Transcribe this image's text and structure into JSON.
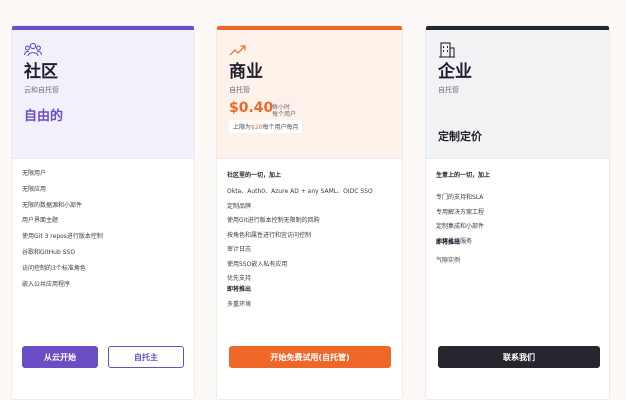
{
  "plans": [
    {
      "name": "社区",
      "subtitle": "云和自托管",
      "price": "自由的",
      "icon": "users-icon",
      "accent": "#6a4fc4",
      "features": [
        "无限用户",
        "无限应用",
        "无限的数据源和小部件",
        "用户界面主题",
        "使用Git 3 repos进行版本控制",
        "谷歌和GitHub SSO",
        "访问控制的3个标准角色",
        "嵌入公共应用程序"
      ],
      "buttons": [
        "从云开始",
        "自托主"
      ]
    },
    {
      "name": "商业",
      "subtitle": "自托管",
      "price": "$0.40",
      "price_note_1": "每小时",
      "price_note_2": "每个用户",
      "cap_prefix": "上限为",
      "cap_amount": "$20",
      "cap_suffix": "每个用户每月",
      "icon": "trending-up-icon",
      "accent": "#f0672a",
      "features": [
        "社区里的一切，加上",
        "Okta、Auth0、Azure AD + any SAML、OIDC SSO",
        "定制品牌",
        "使用Git进行版本控制无限制的回购",
        "按角色和属性进行和宜访问控制",
        "审计日志",
        "使用SSO嵌入私有应用",
        "优先支持"
      ],
      "section_title": "即将推出",
      "section_items": [
        "多重环境"
      ],
      "button": "开始免费试用(自托管)"
    },
    {
      "name": "企业",
      "subtitle": "自托管",
      "price": "定制定价",
      "icon": "building-icon",
      "accent": "#26262e",
      "features": [
        "生意上的一切，加上",
        "专门的支持和SLA",
        "专用解决方案工程",
        "定制集成和小部件",
        "应用迁移服务"
      ],
      "section_title": "即将推出",
      "section_items": [
        "气隙实例"
      ],
      "button": "联系我们"
    }
  ]
}
